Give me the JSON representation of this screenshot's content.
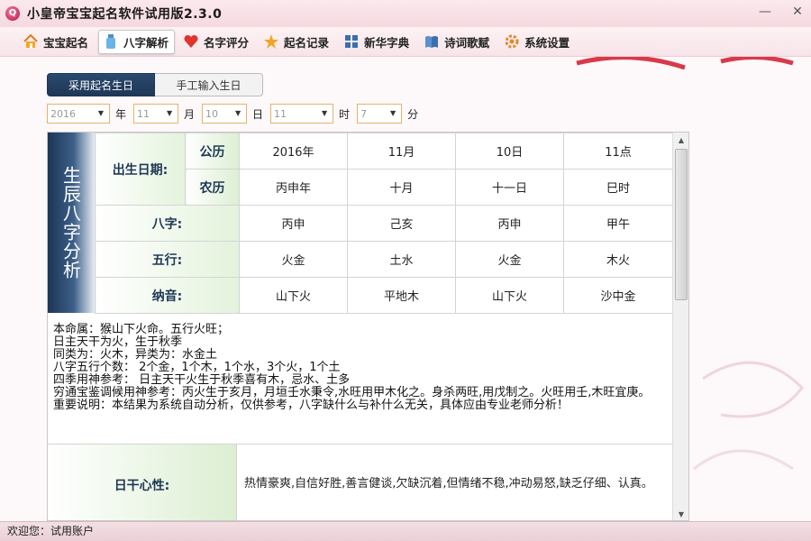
{
  "window": {
    "title": "小皇帝宝宝起名软件试用版2.3.0"
  },
  "toolbar": {
    "items": [
      {
        "label": "宝宝起名",
        "icon": "house-icon"
      },
      {
        "label": "八字解析",
        "icon": "bottle-icon",
        "active": true
      },
      {
        "label": "名字评分",
        "icon": "heart-icon"
      },
      {
        "label": "起名记录",
        "icon": "star-icon"
      },
      {
        "label": "新华字典",
        "icon": "grid-icon"
      },
      {
        "label": "诗词歌赋",
        "icon": "book-icon"
      },
      {
        "label": "系统设置",
        "icon": "gear-icon"
      }
    ]
  },
  "toggle": {
    "use_birth": "采用起名生日",
    "manual": "手工输入生日"
  },
  "date": {
    "year": "2016",
    "year_unit": "年",
    "month": "11",
    "month_unit": "月",
    "day": "10",
    "day_unit": "日",
    "hour": "11",
    "hour_unit": "时",
    "minute": "7",
    "minute_unit": "分"
  },
  "panel": {
    "side_label": "生辰八字分析",
    "birth_label": "出生日期:",
    "gregorian_label": "公历",
    "lunar_label": "农历",
    "gregorian": [
      "2016年",
      "11月",
      "10日",
      "11点"
    ],
    "lunar": [
      "丙申年",
      "十月",
      "十一日",
      "巳时"
    ],
    "bazi_label": "八字:",
    "bazi": [
      "丙申",
      "己亥",
      "丙申",
      "甲午"
    ],
    "wuxing_label": "五行:",
    "wuxing": [
      "火金",
      "土水",
      "火金",
      "木火"
    ],
    "nayin_label": "纳音:",
    "nayin": [
      "山下火",
      "平地木",
      "山下火",
      "沙中金"
    ],
    "analysis": [
      "本命属：猴山下火命。五行火旺；",
      "日主天干为火，生于秋季",
      "同类为：火木，异类为：水金土",
      "八字五行个数：  2个金，1个木，1个水，3个火，1个土",
      "四季用神参考：  日主天干火生于秋季喜有木，忌水、土多",
      "穷通宝鉴调候用神参考：丙火生于亥月，月垣壬水秉令,水旺用甲木化之。身杀两旺,用戊制之。火旺用壬,木旺宜庚。",
      "重要说明：本结果为系统自动分析，仅供参考，八字缺什么与补什么无关，具体应由专业老师分析！"
    ],
    "rigan_label": "日干心性:",
    "rigan_text": "热情豪爽,自信好胜,善言健谈,欠缺沉着,但情绪不稳,冲动易怒,缺乏仔细、认真。"
  },
  "status": {
    "text": "欢迎您：试用账户"
  },
  "colors": {
    "accent": "#1e3755",
    "titlebar": "#f5d9df",
    "label_bg": "#dcefd2"
  }
}
